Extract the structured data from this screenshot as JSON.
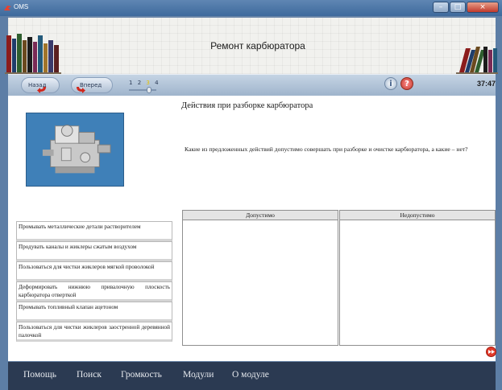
{
  "window": {
    "title": "OMS",
    "min_symbol": "–",
    "max_symbol": "□",
    "close_symbol": "×"
  },
  "header": {
    "title": "Ремонт карбюратора"
  },
  "navbar": {
    "back_label": "Назад",
    "forward_label": "Вперед",
    "pages": [
      "1",
      "2",
      "3",
      "4"
    ],
    "current_page": 3,
    "info_symbol": "i",
    "help_symbol": "?",
    "timer": "37:47"
  },
  "content": {
    "section_title": "Действия при разборке карбюратора",
    "question": "Какие из предложенных действий допустимо совершать при разборке и очистке карбюратора, а какие – нет?",
    "items": [
      "Промывать металлические детали растворителем",
      "Продувать каналы и жиклеры сжатым воздухом",
      "Пользоваться для чистки жиклеров мягкой проволокой",
      "Деформировать нижнюю привалочную плоскость карбюратора отверткой",
      "Промывать топливный клапан ацетоном",
      "Пользоваться для чистки жиклеров заостренной деревянной палочкой"
    ],
    "zones": {
      "allowed": "Допустимо",
      "forbidden": "Недопустимо"
    }
  },
  "menu": {
    "help": "Помощь",
    "search": "Поиск",
    "volume": "Громкость",
    "modules": "Модули",
    "about": "О модуле"
  },
  "colors": {
    "accent_red": "#c0392b",
    "frame": "#5d7ea6",
    "menubar": "#2b3a52"
  }
}
